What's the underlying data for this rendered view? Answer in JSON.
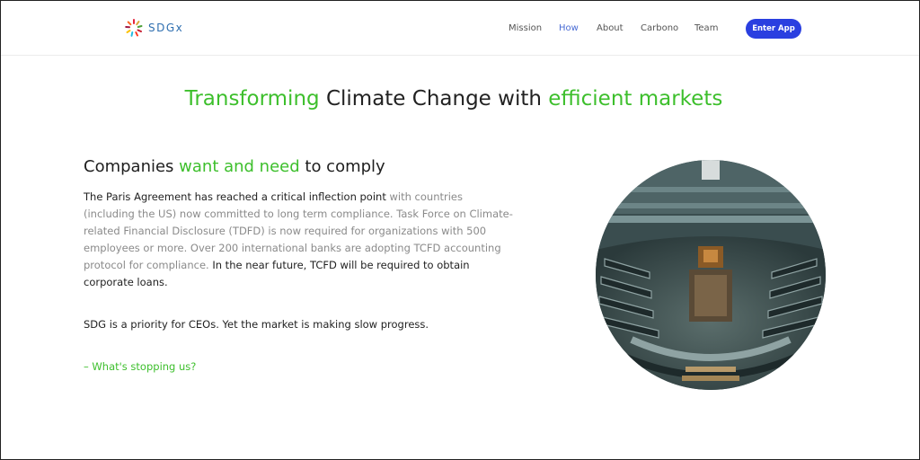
{
  "nav": {
    "logo_text": "SDGx",
    "items": [
      {
        "label": "Mission",
        "active": false
      },
      {
        "label": "How",
        "active": true
      },
      {
        "label": "About",
        "active": false
      },
      {
        "label": "Carbono",
        "active": false
      },
      {
        "label": "Team",
        "active": false
      }
    ],
    "cta_label": "Enter App"
  },
  "hero": {
    "title_part1": "Transforming",
    "title_part2": " Climate Change with ",
    "title_part3": "efficient markets"
  },
  "section": {
    "heading_part1": "Companies ",
    "heading_part2": "want and need",
    "heading_part3": " to comply",
    "para_bold1": "The Paris Agreement has reached a critical inflection point",
    "para_text1": " with countries (including the US) now committed to long term compliance. Task Force on Climate-related Financial Disclosure (TDFD) is now required for organizations with 500 employees or more. Over 200 international banks are adopting TCFD accounting protocol for compliance.",
    "para_bold2": " In the near future, TCFD will be required to obtain corporate loans.",
    "line2": "SDG is a priority for CEOs. Yet the market is making slow progress.",
    "link": "– What's stopping us?"
  },
  "image": {
    "subject": "parliament chamber photo"
  },
  "colors": {
    "accent_green": "#3dbf2c",
    "button_blue": "#2a3fe0",
    "nav_active": "#4a6cd4"
  }
}
